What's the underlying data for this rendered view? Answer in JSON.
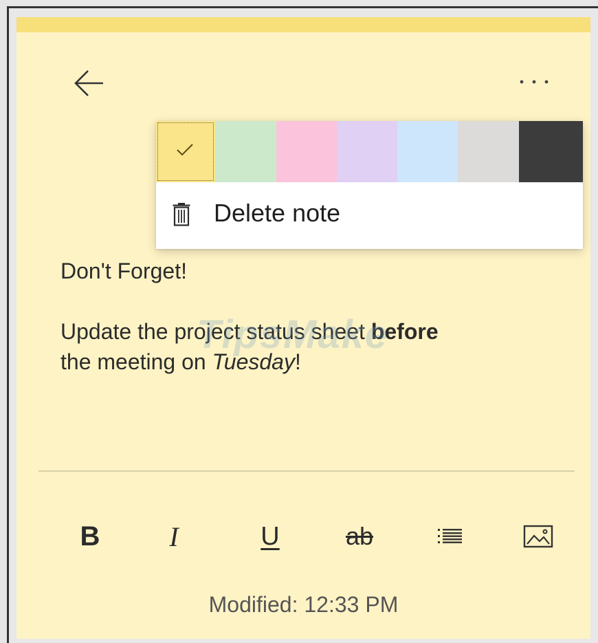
{
  "theme": {
    "note_background": "#fef3c5",
    "note_accent_bar": "#f7df7a"
  },
  "header": {
    "back_icon": "arrow-left-icon",
    "more_icon": "ellipsis-icon"
  },
  "menu": {
    "swatches": [
      {
        "name": "Yellow",
        "color": "#fbe58a",
        "selected": true
      },
      {
        "name": "Green",
        "color": "#cde9cc"
      },
      {
        "name": "Pink",
        "color": "#fbc3dc"
      },
      {
        "name": "Purple",
        "color": "#e0d0f3"
      },
      {
        "name": "Blue",
        "color": "#cde6fb"
      },
      {
        "name": "Gray",
        "color": "#dcdbda"
      },
      {
        "name": "Charcoal",
        "color": "#3c3c3c"
      }
    ],
    "delete_label": "Delete note",
    "delete_icon": "trash-icon"
  },
  "note": {
    "line1": "Don't Forget!",
    "line2_prefix": "Update the project status sheet ",
    "line2_bold": "before",
    "line3_prefix": "the meeting on ",
    "line3_italic": "Tuesday",
    "line3_suffix": "!"
  },
  "watermark": "TipsMake",
  "toolbar": {
    "bold": "B",
    "italic": "I",
    "underline": "U",
    "strikethrough": "ab",
    "list_icon": "bullet-list-icon",
    "image_icon": "image-icon"
  },
  "status": {
    "modified": "Modified: 12:33 PM"
  }
}
